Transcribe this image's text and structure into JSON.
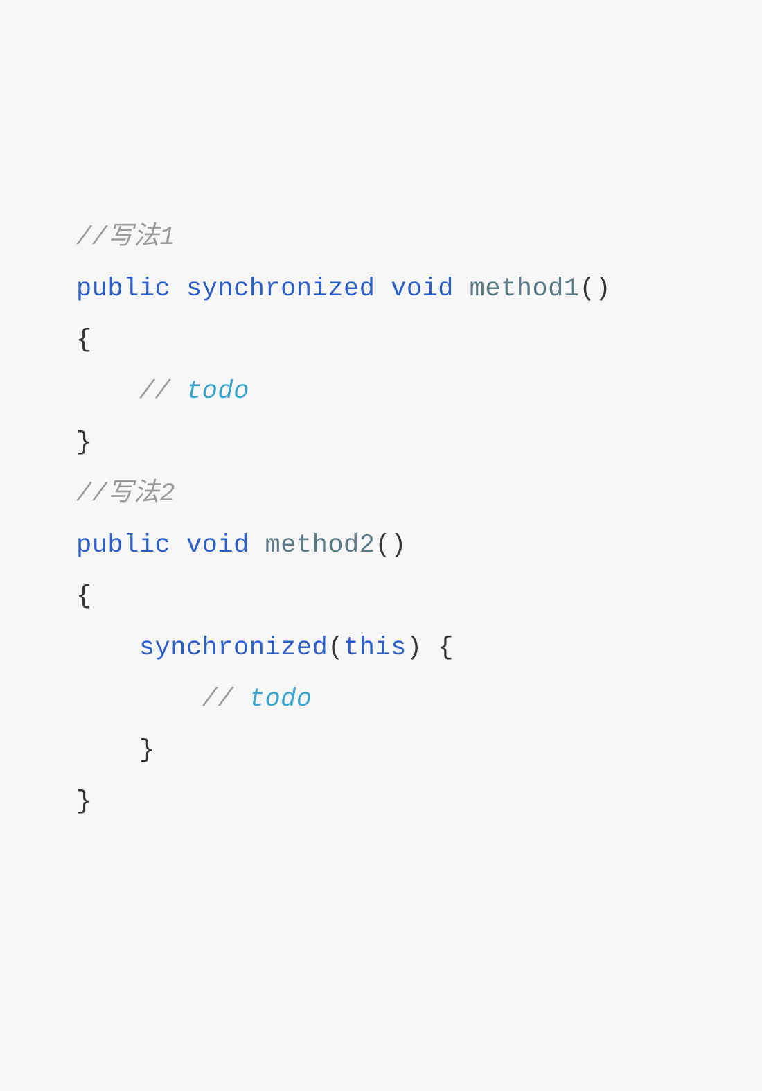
{
  "code": {
    "lines": [
      {
        "id": "l1",
        "indent": "",
        "tokens": [
          {
            "cls": "comment",
            "text": "//写法1"
          }
        ]
      },
      {
        "id": "l2",
        "indent": "",
        "tokens": [
          {
            "cls": "keyword",
            "text": "public"
          },
          {
            "cls": "",
            "text": " "
          },
          {
            "cls": "keyword",
            "text": "synchronized"
          },
          {
            "cls": "",
            "text": " "
          },
          {
            "cls": "kw-void",
            "text": "void"
          },
          {
            "cls": "",
            "text": " "
          },
          {
            "cls": "methodname",
            "text": "method1"
          },
          {
            "cls": "punct",
            "text": "()"
          }
        ]
      },
      {
        "id": "l3",
        "indent": "",
        "tokens": [
          {
            "cls": "punct",
            "text": "{"
          }
        ]
      },
      {
        "id": "l4",
        "indent": "    ",
        "tokens": [
          {
            "cls": "comment-slash",
            "text": "// "
          },
          {
            "cls": "comment-italic",
            "text": "todo"
          }
        ]
      },
      {
        "id": "l5",
        "indent": "",
        "tokens": [
          {
            "cls": "punct",
            "text": "}"
          }
        ]
      },
      {
        "id": "l6",
        "indent": "",
        "tokens": [
          {
            "cls": "comment",
            "text": "//写法2"
          }
        ]
      },
      {
        "id": "l7",
        "indent": "",
        "tokens": [
          {
            "cls": "keyword",
            "text": "public"
          },
          {
            "cls": "",
            "text": " "
          },
          {
            "cls": "kw-void",
            "text": "void"
          },
          {
            "cls": "",
            "text": " "
          },
          {
            "cls": "methodname",
            "text": "method2"
          },
          {
            "cls": "punct",
            "text": "()"
          }
        ]
      },
      {
        "id": "l8",
        "indent": "",
        "tokens": [
          {
            "cls": "punct",
            "text": "{"
          }
        ]
      },
      {
        "id": "l9",
        "indent": "    ",
        "tokens": [
          {
            "cls": "keyword",
            "text": "synchronized"
          },
          {
            "cls": "punct",
            "text": "("
          },
          {
            "cls": "this-kw",
            "text": "this"
          },
          {
            "cls": "punct",
            "text": ") {"
          }
        ]
      },
      {
        "id": "l10",
        "indent": "        ",
        "tokens": [
          {
            "cls": "comment-slash",
            "text": "// "
          },
          {
            "cls": "comment-italic",
            "text": "todo"
          }
        ]
      },
      {
        "id": "l11",
        "indent": "    ",
        "tokens": [
          {
            "cls": "punct",
            "text": "}"
          }
        ]
      },
      {
        "id": "l12",
        "indent": "",
        "tokens": [
          {
            "cls": "punct",
            "text": "}"
          }
        ]
      }
    ]
  }
}
